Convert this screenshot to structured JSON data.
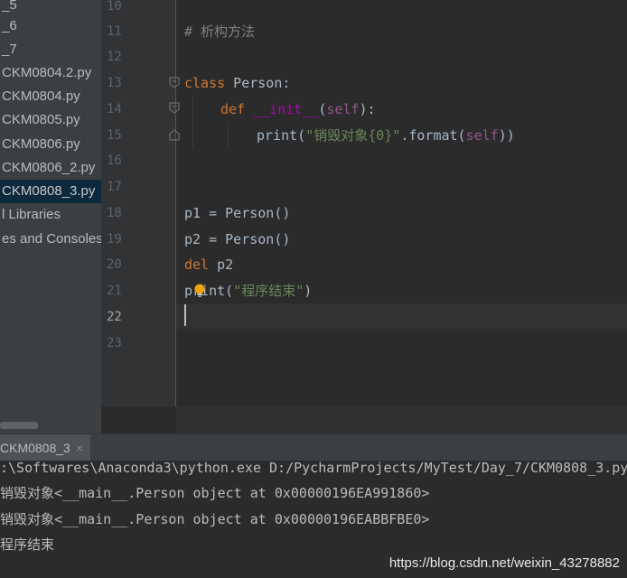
{
  "sidebar": {
    "items": [
      {
        "label": "_5"
      },
      {
        "label": "_6"
      },
      {
        "label": "_7"
      },
      {
        "label": "CKM0804.2.py"
      },
      {
        "label": "CKM0804.py"
      },
      {
        "label": "CKM0805.py"
      },
      {
        "label": "CKM0806.py"
      },
      {
        "label": "CKM0806_2.py"
      },
      {
        "label": "CKM0808_3.py"
      },
      {
        "label": "l Libraries"
      },
      {
        "label": "es and Consoles"
      }
    ],
    "selected_index": 8
  },
  "editor": {
    "line_numbers": [
      "10",
      "11",
      "12",
      "13",
      "14",
      "15",
      "16",
      "17",
      "18",
      "19",
      "20",
      "21",
      "22",
      "23"
    ],
    "current_line": "22",
    "code": {
      "l11_comment": "# 析构方法",
      "l13_kw": "class",
      "l13_rest": " Person:",
      "l14_kw": "def",
      "l14_sp": " ",
      "l14_name": "__init__",
      "l14_open": "(",
      "l14_self": "self",
      "l14_close": "):",
      "l15_print": "print(",
      "l15_str": "\"销毁对象{0}\"",
      "l15_fmt": ".format(",
      "l15_self": "self",
      "l15_end": "))",
      "l18": "p1 = Person()",
      "l19": "p2 = Person()",
      "l20_kw": "del",
      "l20_rest": " p2",
      "l21_print": "print(",
      "l21_str": "\"程序结束\"",
      "l21_end": ")"
    }
  },
  "run_panel": {
    "tab_label": "CKM0808_3",
    "close_glyph": "×",
    "lines": [
      ":\\Softwares\\Anaconda3\\python.exe D:/PycharmProjects/MyTest/Day_7/CKM0808_3.py",
      "销毁对象<__main__.Person object at 0x00000196EA991860>",
      "销毁对象<__main__.Person object at 0x00000196EABBFBE0>",
      "程序结束"
    ]
  },
  "watermark": "https://blog.csdn.net/weixin_43278882",
  "colors": {
    "background": "#2b2b2b",
    "keyword": "#cc7832",
    "self": "#94558d",
    "magic": "#b200b2",
    "string": "#6a8759",
    "comment": "#808080",
    "text": "#a9b7c6",
    "bulb": "#f0a30a"
  }
}
